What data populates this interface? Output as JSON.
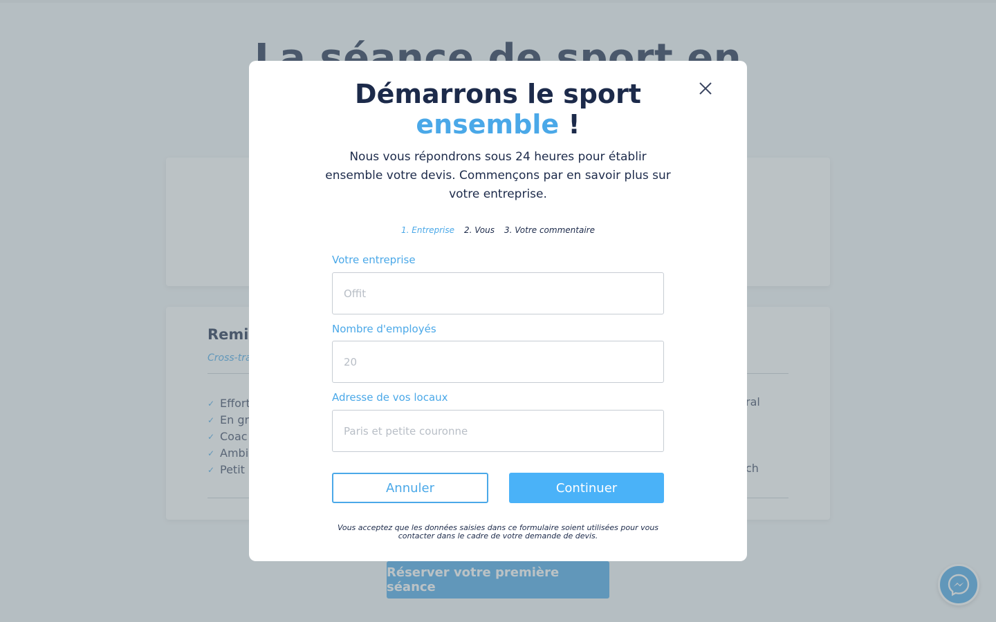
{
  "background": {
    "hero_title": "La séance de sport en",
    "card_title": "Remis",
    "card_subtitle": "Cross-tra",
    "list": [
      "Effort",
      "En gr",
      "Coac",
      "Ambi",
      "Petit"
    ],
    "right_text_1": "ral",
    "right_text_2": "ch",
    "cta_label": "Réserver votre première séance",
    "messenger_icon": "messenger-icon"
  },
  "modal": {
    "title_line1": "Démarrons le sport",
    "title_accent": "ensemble",
    "title_end": " !",
    "intro": "Nous vous répondrons sous 24 heures pour établir ensemble votre devis. Commençons par en savoir plus sur votre entreprise.",
    "steps": [
      {
        "label": "1. Entreprise",
        "active": true
      },
      {
        "label": "2. Vous",
        "active": false
      },
      {
        "label": "3. Votre commentaire",
        "active": false
      }
    ],
    "fields": {
      "company_label": "Votre entreprise",
      "company_placeholder": "Offit",
      "employees_label": "Nombre d'employés",
      "employees_placeholder": "20",
      "address_label": "Adresse de vos locaux",
      "address_placeholder": "Paris et petite couronne"
    },
    "cancel_label": "Annuler",
    "continue_label": "Continuer",
    "disclaimer": "Vous acceptez que les données saisies dans ce formulaire soient utilisées pour vous contacter dans le cadre de votre demande de devis."
  },
  "colors": {
    "accent": "#4aa8e8",
    "navy": "#1c2a4a",
    "overlay": "rgba(120,134,140,0.5)"
  }
}
